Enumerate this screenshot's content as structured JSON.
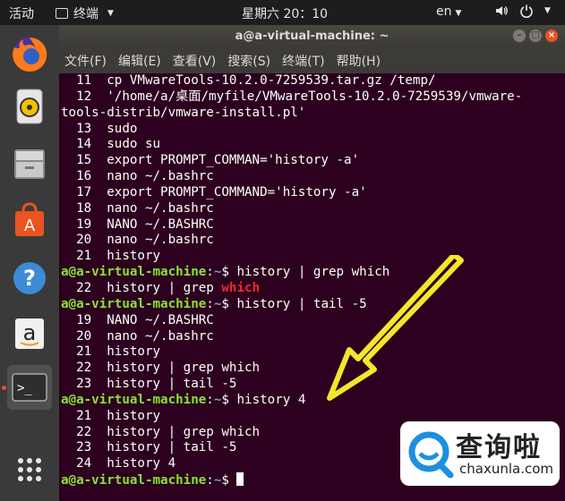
{
  "topbar": {
    "activities": "活动",
    "app_menu": "终端",
    "clock": "星期六 20：10",
    "language": "en"
  },
  "window": {
    "title": "a@a-virtual-machine: ~"
  },
  "menubar": [
    "文件(F)",
    "编辑(E)",
    "查看(V)",
    "搜索(S)",
    "终端(T)",
    "帮助(H)"
  ],
  "terminal": {
    "prompt_user": "a@a-virtual-machine",
    "prompt_sep": ":",
    "prompt_path": "~",
    "prompt_end": "$ ",
    "lines": [
      {
        "t": "text",
        "v": "  11  cp VMwareTools-10.2.0-7259539.tar.gz /temp/"
      },
      {
        "t": "text",
        "v": "  12  '/home/a/桌面/myfile/VMwareTools-10.2.0-7259539/vmware-"
      },
      {
        "t": "text",
        "v": "tools-distrib/vmware-install.pl'"
      },
      {
        "t": "text",
        "v": "  13  sudo"
      },
      {
        "t": "text",
        "v": "  14  sudo su"
      },
      {
        "t": "text",
        "v": "  15  export PROMPT_COMMAN='history -a'"
      },
      {
        "t": "text",
        "v": "  16  nano ~/.bashrc"
      },
      {
        "t": "text",
        "v": "  17  export PROMPT_COMMAND='history -a'"
      },
      {
        "t": "text",
        "v": "  18  nano ~/.bashrc"
      },
      {
        "t": "text",
        "v": "  19  NANO ~/.BASHRC"
      },
      {
        "t": "text",
        "v": "  20  nano ~/.bashrc"
      },
      {
        "t": "text",
        "v": "  21  history"
      },
      {
        "t": "prompt",
        "cmd": "history | grep which"
      },
      {
        "t": "hl",
        "pre": "  22  history | grep ",
        "hl": "which"
      },
      {
        "t": "prompt",
        "cmd": "history | tail -5"
      },
      {
        "t": "text",
        "v": "  19  NANO ~/.BASHRC"
      },
      {
        "t": "text",
        "v": "  20  nano ~/.bashrc"
      },
      {
        "t": "text",
        "v": "  21  history"
      },
      {
        "t": "text",
        "v": "  22  history | grep which"
      },
      {
        "t": "text",
        "v": "  23  history | tail -5"
      },
      {
        "t": "prompt",
        "cmd": "history 4"
      },
      {
        "t": "text",
        "v": "  21  history"
      },
      {
        "t": "text",
        "v": "  22  history | grep which"
      },
      {
        "t": "text",
        "v": "  23  history | tail -5"
      },
      {
        "t": "text",
        "v": "  24  history 4"
      },
      {
        "t": "prompt",
        "cmd": "",
        "cursor": true
      }
    ]
  },
  "dock": [
    "firefox-icon",
    "rhythmbox-icon",
    "files-icon",
    "software-center-icon",
    "help-icon",
    "amazon-icon",
    "terminal-icon",
    "show-apps-icon"
  ],
  "watermark": {
    "logo_text": "查询啦",
    "domain": "chaxunla.com"
  },
  "colors": {
    "terminal_bg": "#2c001e",
    "prompt_user": "#8ae234",
    "prompt_path": "#729fcf",
    "highlight": "#ef2929",
    "arrow": "#f5e62a"
  }
}
